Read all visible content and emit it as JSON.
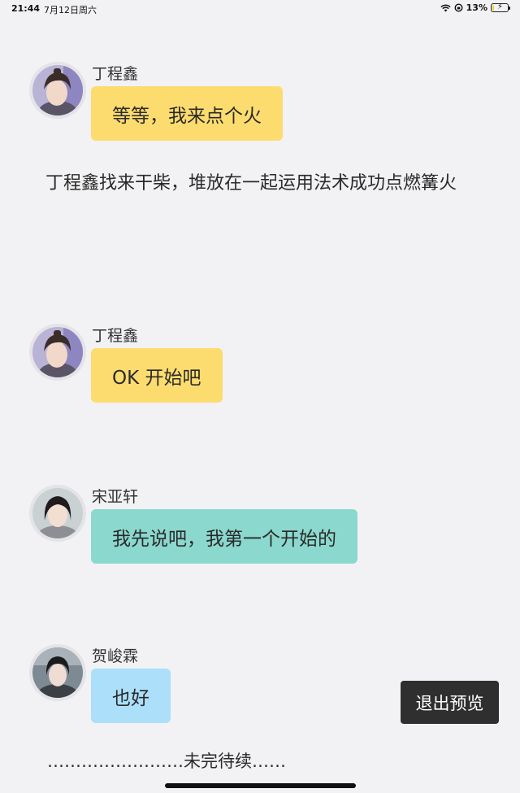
{
  "status_bar": {
    "time": "21:44",
    "date": "7月12日周六",
    "battery_percent": "13%",
    "battery_level": 0.13
  },
  "messages": [
    {
      "name": "丁程鑫",
      "text": "等等，我来点个火",
      "bubble_color": "#fddc6f"
    },
    {
      "name": "丁程鑫",
      "text": "OK 开始吧",
      "bubble_color": "#fddc6f"
    },
    {
      "name": "宋亚轩",
      "text": "我先说吧，我第一个开始的",
      "bubble_color": "#8bd8ce"
    },
    {
      "name": "贺峻霖",
      "text": "也好",
      "bubble_color": "#abdffa"
    }
  ],
  "narration": "丁程鑫找来干柴，堆放在一起运用法术成功点燃篝火",
  "exit_button_label": "退出预览",
  "to_be_continued": "……………………未完待续……"
}
